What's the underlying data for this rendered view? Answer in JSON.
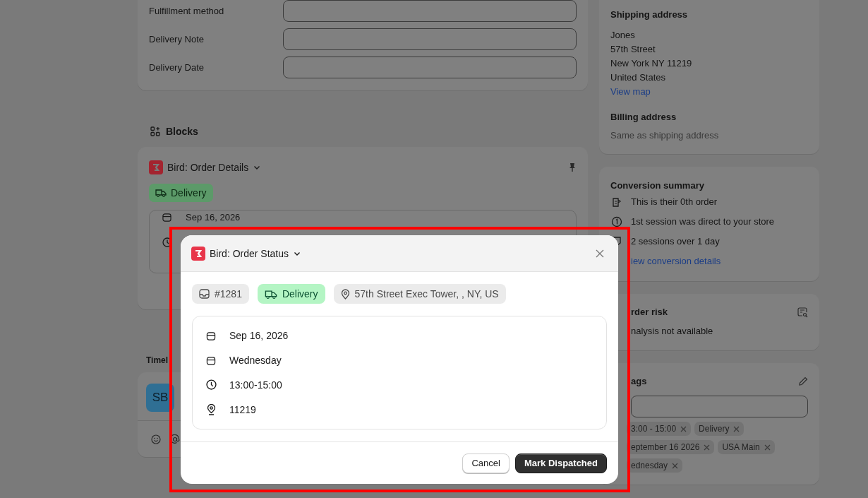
{
  "order_fields": [
    {
      "label": "Fulfillment method"
    },
    {
      "label": "Delivery Note"
    },
    {
      "label": "Delivery Date"
    }
  ],
  "blocks": {
    "heading": "Blocks",
    "card": {
      "app_name": "Bird: Order Details",
      "badge": "Delivery",
      "details": [
        {
          "kind": "calendar",
          "text": "Sep 16, 2026"
        },
        {
          "kind": "clock"
        }
      ]
    }
  },
  "timeline": {
    "heading": "Timel",
    "avatar": "SB"
  },
  "shipping": {
    "heading": "Shipping address",
    "lines": [
      "Jones",
      "57th Street",
      "New York NY 11219",
      "United States"
    ],
    "link": "View map"
  },
  "billing": {
    "heading": "Billing address",
    "text": "Same as shipping address"
  },
  "conversion": {
    "heading": "Conversion summary",
    "items": [
      {
        "kind": "orders",
        "text": "This is their 0th order"
      },
      {
        "kind": "session",
        "text": "1st session was direct to your store"
      },
      {
        "kind": "visits",
        "text": "2 sessions over 1 day"
      }
    ],
    "link": "iew conversion details"
  },
  "order_risk": {
    "heading": "rder risk",
    "text": "nalysis not available"
  },
  "tags": {
    "heading": "ags",
    "items": [
      "3:00 - 15:00",
      "Delivery",
      "eptember 16 2026",
      "USA Main",
      "ednesday"
    ]
  },
  "modal": {
    "title": "Bird: Order Status",
    "chips": [
      {
        "kind": "order",
        "text": "#1281"
      },
      {
        "kind": "delivery",
        "text": "Delivery"
      },
      {
        "kind": "location",
        "text": "57th Street Exec Tower, , NY, US"
      }
    ],
    "details": [
      {
        "kind": "calendar",
        "text": "Sep 16, 2026"
      },
      {
        "kind": "calendar",
        "text": "Wednesday"
      },
      {
        "kind": "clock",
        "text": "13:00-15:00"
      },
      {
        "kind": "location",
        "text": "11219"
      }
    ],
    "buttons": [
      {
        "kind": "secondary",
        "label": "Cancel"
      },
      {
        "kind": "primary",
        "label": "Mark Dispatched"
      }
    ]
  }
}
